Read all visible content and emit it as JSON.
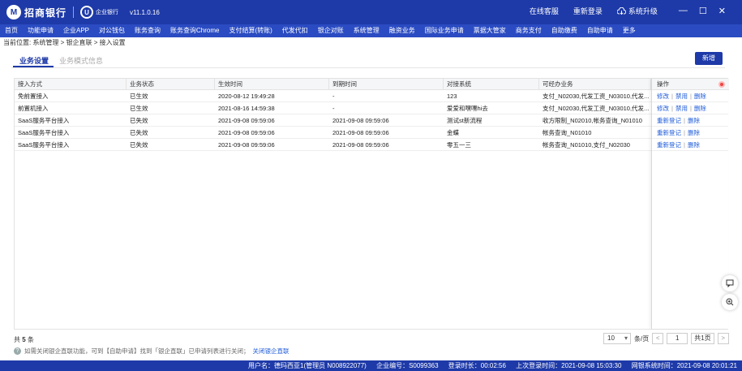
{
  "app": {
    "bank_name": "招商银行",
    "bank_mark": "M",
    "sub_brand": "企业银行",
    "sub_mark": "U",
    "version": "v11.1.0.16"
  },
  "top_links": {
    "service": "在线客服",
    "relogin": "重新登录",
    "upgrade": "系统升级"
  },
  "window_controls": {
    "min": "—",
    "max": "☐",
    "close": "✕"
  },
  "nav": [
    "首页",
    "功能申请",
    "企业APP",
    "对公钱包",
    "账务查询",
    "账务查询Chrome",
    "支付结算(转账)",
    "代发代扣",
    "银企对账",
    "系统管理",
    "融资业务",
    "国际业务申请",
    "票据大管家",
    "商务支付",
    "自助缴费",
    "自助申请",
    "更多"
  ],
  "breadcrumb": "当前位置: 系统管理 > 银企直联 > 接入设置",
  "tabs": {
    "active": "业务设置",
    "inactive": "业务模式信息"
  },
  "new_button": "新增",
  "columns": [
    "接入方式",
    "业务状态",
    "生效时间",
    "到期时间",
    "对接系统",
    "可经办业务"
  ],
  "ops_header": "操作",
  "rows": [
    {
      "mode": "免前置接入",
      "status": "已生效",
      "start": "2020-08-12 19:49:28",
      "end": "-",
      "system": "123",
      "biz": "支付_N02030,代发工资_N03010,代发...",
      "ops": [
        "修改",
        "禁用",
        "删除"
      ]
    },
    {
      "mode": "前置机接入",
      "status": "已生效",
      "start": "2021-08-16 14:59:38",
      "end": "-",
      "system": "爱爱和嘿嘿hi去",
      "biz": "支付_N02030,代发工资_N03010,代发...",
      "ops": [
        "修改",
        "禁用",
        "删除"
      ]
    },
    {
      "mode": "SaaS服务平台接入",
      "status": "已失效",
      "start": "2021-09-08 09:59:06",
      "end": "2021-09-08 09:59:06",
      "system": "测试st新流程",
      "biz": "收方限制_N02010,帐务查询_N01010",
      "ops": [
        "重新登记",
        "删除"
      ]
    },
    {
      "mode": "SaaS服务平台接入",
      "status": "已失效",
      "start": "2021-09-08 09:59:06",
      "end": "2021-09-08 09:59:06",
      "system": "金蝶",
      "biz": "帐务查询_N01010",
      "ops": [
        "重新登记",
        "删除"
      ]
    },
    {
      "mode": "SaaS服务平台接入",
      "status": "已失效",
      "start": "2021-09-08 09:59:06",
      "end": "2021-09-08 09:59:06",
      "system": "零五一三",
      "biz": "帐务查询_N01010,支付_N02030",
      "ops": [
        "重新登记",
        "删除"
      ]
    }
  ],
  "footer": {
    "total_prefix": "共",
    "total": "5",
    "total_suffix": "条",
    "page_size": "10",
    "page_size_unit": "条/页",
    "prev": "<",
    "page": "1",
    "total_pages": "共1页",
    "next": ">"
  },
  "tip": {
    "text": "如需关闭银企直联功能，可到【自助申请】找到「银企直联」已申请列表进行关闭；",
    "link": "关闭银企直联"
  },
  "status": {
    "user": "用户名：德玛西亚1(管理员 N008922077)",
    "company": "企业编号：S0099363",
    "duration": "登录时长：00:02:56",
    "last_login": "上次登录时间：2021-09-08 15:03:30",
    "bank_time": "网银系统时间：2021-09-08 20:01:21"
  },
  "colors": {
    "brand": "#1e3aa8",
    "link": "#1e5bd8"
  }
}
